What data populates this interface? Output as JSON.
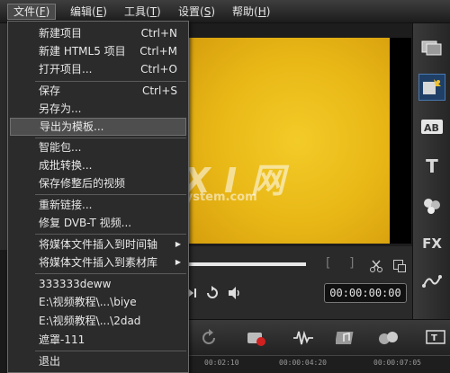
{
  "menubar": {
    "items": [
      {
        "label": "文件(",
        "acc": "F",
        "tail": ")"
      },
      {
        "label": "编辑(",
        "acc": "E",
        "tail": ")"
      },
      {
        "label": "工具(",
        "acc": "T",
        "tail": ")"
      },
      {
        "label": "设置(",
        "acc": "S",
        "tail": ")"
      },
      {
        "label": "帮助(",
        "acc": "H",
        "tail": ")"
      }
    ]
  },
  "file_menu": {
    "new_project": {
      "label": "新建项目",
      "shortcut": "Ctrl+N"
    },
    "new_html5_project": {
      "label": "新建 HTML5 项目",
      "shortcut": "Ctrl+M"
    },
    "open_project": {
      "label": "打开项目...",
      "shortcut": "Ctrl+O"
    },
    "save": {
      "label": "保存",
      "shortcut": "Ctrl+S"
    },
    "save_as": {
      "label": "另存为..."
    },
    "export_template": {
      "label": "导出为模板..."
    },
    "smart_package": {
      "label": "智能包..."
    },
    "batch_convert": {
      "label": "成批转换..."
    },
    "save_trimmed_video": {
      "label": "保存修整后的视频"
    },
    "relink": {
      "label": "重新链接..."
    },
    "repair_dvbt": {
      "label": "修复 DVB-T 视频..."
    },
    "insert_to_timeline": {
      "label": "将媒体文件插入到时间轴"
    },
    "insert_to_library": {
      "label": "将媒体文件插入到素材库"
    },
    "recent": [
      "333333deww",
      "E:\\视频教程\\...\\biye",
      "E:\\视频教程\\...\\2dad",
      "遮罩-111"
    ],
    "exit": {
      "label": "退出"
    }
  },
  "player": {
    "timecode": "00:00:00:00"
  },
  "timeline": {
    "ruler_ticks": [
      "00:02:10",
      "00:00:04:20",
      "00:00:07:05"
    ]
  },
  "right_toolbar": {
    "icons": [
      "media-icon",
      "instant-project-icon",
      "transition-icon",
      "title-icon",
      "graphic-icon",
      "filter-icon",
      "path-icon"
    ],
    "title_glyph": "T",
    "filter_glyph": "FX",
    "transition_glyph": "AB"
  },
  "watermark": {
    "logo": "G X I 网",
    "sub": "system.com"
  },
  "colors": {
    "preview_fill": "#f0c020",
    "menu_bg": "#2b2b2b",
    "highlight": "#4e4e4e"
  }
}
